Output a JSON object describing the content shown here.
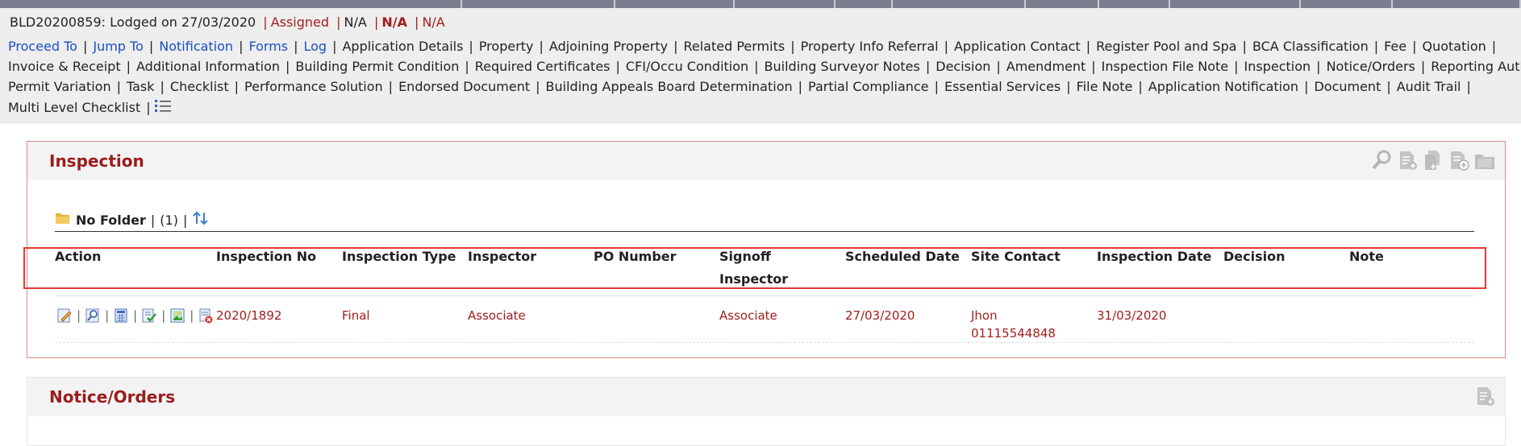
{
  "header": {
    "app_id": "BLD20200859:",
    "lodged": "Lodged on 27/03/2020",
    "status": "Assigned",
    "na1": "N/A",
    "na2": "N/A",
    "na3": "N/A",
    "sep": "|"
  },
  "nav": {
    "row1": [
      "Proceed To",
      "Jump To",
      "Notification",
      "Forms",
      "Log",
      "Application Details",
      "Property",
      "Adjoining Property",
      "Related Permits",
      "Property Info Referral",
      "Application Contact",
      "Register Pool and Spa",
      "BCA Classification",
      "Fee",
      "Quotation"
    ],
    "row2": [
      "Invoice & Receipt",
      "Additional Information",
      "Building Permit Condition",
      "Required Certificates",
      "CFI/Occu Condition",
      "Building Surveyor Notes",
      "Decision",
      "Amendment",
      "Inspection File Note",
      "Inspection",
      "Notice/Orders",
      "Reporting Authority"
    ],
    "row3": [
      "Permit Variation",
      "Task",
      "Checklist",
      "Performance Solution",
      "Endorsed Document",
      "Building Appeals Board Determination",
      "Partial Compliance",
      "Essential Services",
      "File Note",
      "Application Notification",
      "Document",
      "Audit Trail"
    ],
    "row4": [
      "Multi Level Checklist"
    ],
    "list_icon": "list-icon"
  },
  "inspection": {
    "title": "Inspection",
    "folder": {
      "name": "No Folder",
      "count": "(1)",
      "bar": "|"
    },
    "tools": [
      "wrench-search-icon",
      "add-document-icon",
      "copy-document-icon",
      "add-circle-document-icon",
      "folder-icon"
    ],
    "columns": [
      "Action",
      "Inspection No",
      "Inspection Type",
      "Inspector",
      "PO Number",
      "Signoff Inspector",
      "Scheduled Date",
      "Site Contact",
      "Inspection Date",
      "Decision",
      "Note"
    ],
    "rows": [
      {
        "inspection_no": "2020/1892",
        "inspection_type": "Final",
        "inspector": "Associate",
        "po_number": "",
        "signoff_inspector": "Associate",
        "scheduled_date": "27/03/2020",
        "site_contact_name": "Jhon",
        "site_contact_phone": "01115544848",
        "inspection_date": "31/03/2020",
        "decision": "",
        "note": "",
        "actions": [
          "edit-icon",
          "search-icon",
          "calculator-icon",
          "checklist-icon",
          "image-icon",
          "delete-icon"
        ]
      }
    ]
  },
  "notice_orders": {
    "title": "Notice/Orders",
    "tool": "add-document-icon"
  },
  "colors": {
    "accent_red": "#9b1b1b",
    "link_blue": "#1b4fc4",
    "highlight": "#e53935"
  }
}
